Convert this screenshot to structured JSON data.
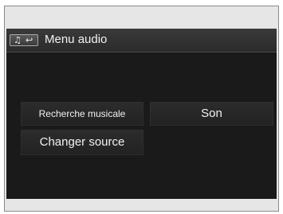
{
  "header": {
    "icon_music": "music-note-icon",
    "icon_back": "back-arrow-icon",
    "title": "Menu audio"
  },
  "menu": {
    "items": [
      {
        "label": "Recherche musicale"
      },
      {
        "label": "Son"
      },
      {
        "label": "Changer source"
      }
    ]
  },
  "colors": {
    "screen_background": "#1a1a1a",
    "header_background": "#2f2f2f",
    "button_background": "#262626",
    "text": "#f2f2f2"
  }
}
